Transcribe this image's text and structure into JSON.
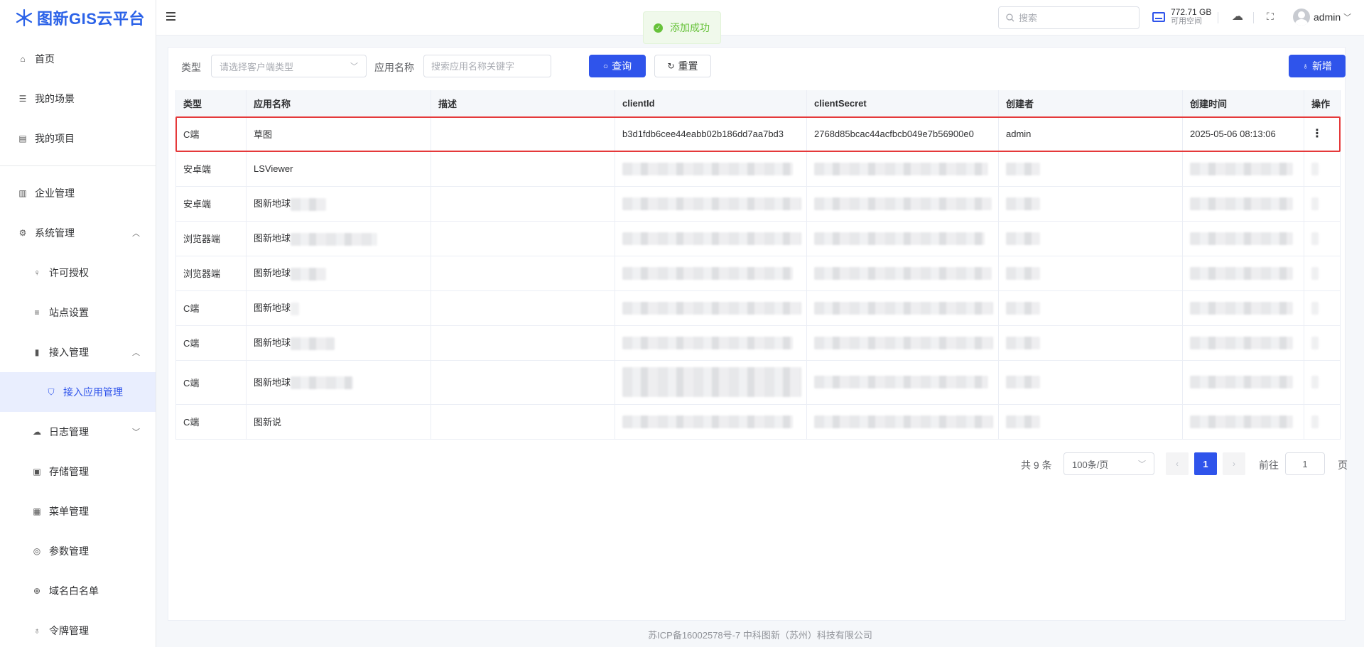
{
  "app": {
    "title": "图新GIS云平台"
  },
  "sidebar": {
    "items": [
      {
        "label": "首页",
        "icon": "home-icon"
      },
      {
        "label": "我的场景",
        "icon": "list-icon"
      },
      {
        "label": "我的项目",
        "icon": "project-icon"
      },
      {
        "label": "企业管理",
        "icon": "building-icon"
      },
      {
        "label": "系统管理",
        "icon": "gear-icon"
      },
      {
        "label": "许可授权",
        "icon": "bulb-icon"
      },
      {
        "label": "站点设置",
        "icon": "sliders-icon"
      },
      {
        "label": "接入管理",
        "icon": "book-icon"
      },
      {
        "label": "接入应用管理",
        "icon": "shield-icon"
      },
      {
        "label": "日志管理",
        "icon": "cloud-icon"
      },
      {
        "label": "存储管理",
        "icon": "box-icon"
      },
      {
        "label": "菜单管理",
        "icon": "grid-icon"
      },
      {
        "label": "参数管理",
        "icon": "circle-gear-icon"
      },
      {
        "label": "域名白名单",
        "icon": "globe-icon"
      },
      {
        "label": "令牌管理",
        "icon": "key-icon"
      }
    ]
  },
  "header": {
    "search_placeholder": "搜索",
    "disk_size": "772.71 GB",
    "disk_label": "可用空间",
    "user_name": "admin"
  },
  "toast": {
    "text": "添加成功"
  },
  "filters": {
    "type_label": "类型",
    "type_placeholder": "请选择客户端类型",
    "name_label": "应用名称",
    "name_placeholder": "搜索应用名称关键字",
    "query_label": "查询",
    "reset_label": "重置",
    "add_label": "新增"
  },
  "table": {
    "columns": [
      "类型",
      "应用名称",
      "描述",
      "clientId",
      "clientSecret",
      "创建者",
      "创建时间",
      "操作"
    ],
    "rows": [
      {
        "type": "C端",
        "name": "草图",
        "desc": "",
        "client_id": "b3d1fdb6cee44eabb02b186dd7aa7bd3",
        "client_secret": "2768d85bcac44acfbcb049e7b56900e0",
        "creator": "admin",
        "created": "2025-05-06 08:13:06"
      },
      {
        "type": "安卓端",
        "name": "LSViewer"
      },
      {
        "type": "安卓端",
        "name": "图新地球"
      },
      {
        "type": "浏览器端",
        "name": "图新地球"
      },
      {
        "type": "浏览器端",
        "name": "图新地球"
      },
      {
        "type": "C端",
        "name": "图新地球"
      },
      {
        "type": "C端",
        "name": "图新地球"
      },
      {
        "type": "C端",
        "name": "图新地球"
      },
      {
        "type": "C端",
        "name": "图新说"
      }
    ]
  },
  "pagination": {
    "total": "共 9 条",
    "page_size": "100条/页",
    "current": "1",
    "goto_label": "前往",
    "goto_value": "1",
    "page_suffix": "页"
  },
  "footer": {
    "text": "苏ICP备16002578号-7 中科图新（苏州）科技有限公司"
  },
  "colors": {
    "primary": "#2f54eb",
    "success": "#67c23a",
    "highlight": "#e5393a"
  }
}
